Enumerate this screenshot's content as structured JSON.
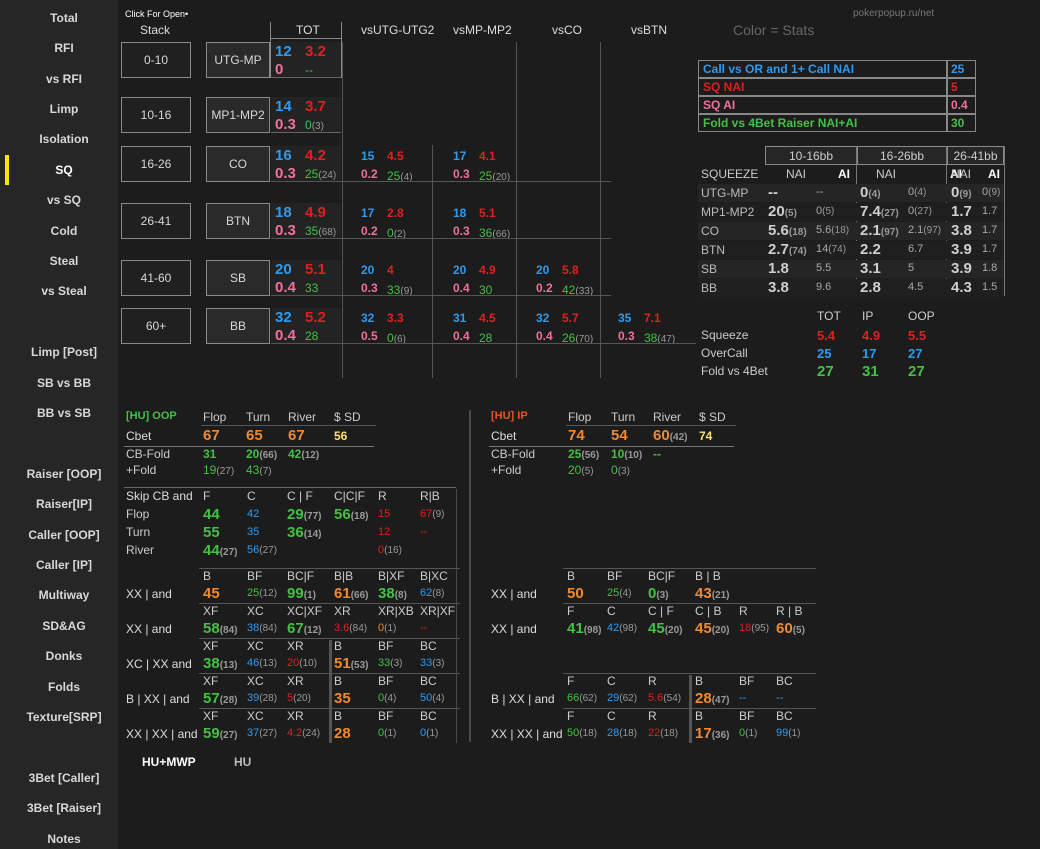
{
  "site": "pokerpopup.ru/net",
  "hint": "Click For Open•",
  "color_label": "Color = Stats",
  "nav": [
    "Total",
    "RFI",
    "vs RFI",
    "Limp",
    "Isolation",
    "SQ",
    "vs SQ",
    "Cold",
    "Steal",
    "vs Steal",
    "Limp [Post]",
    "SB vs BB",
    "BB vs SB",
    "Raiser [OOP]",
    "Raiser[IP]",
    "Caller [OOP]",
    "Caller [IP]",
    "Multiway",
    "SD&AG",
    "Donks",
    "Folds",
    "Texture[SRP]",
    "3Bet [Caller]",
    "3Bet [Raiser]",
    "Notes"
  ],
  "grid": {
    "stack_header": "Stack",
    "col_headers": [
      "TOT",
      "vsUTG-UTG2",
      "vsMP-MP2",
      "vsCO",
      "vsBTN"
    ],
    "stacks": [
      "0-10",
      "10-16",
      "16-26",
      "26-41",
      "41-60",
      "60+"
    ],
    "positions": [
      "UTG-MP",
      "MP1-MP2",
      "CO",
      "BTN",
      "SB",
      "BB"
    ],
    "tot": [
      {
        "a": "12",
        "b": "3.2",
        "c": "0",
        "d": "--",
        "e": ""
      },
      {
        "a": "14",
        "b": "3.7",
        "c": "0.3",
        "d": "0",
        "e": "(3)"
      },
      {
        "a": "16",
        "b": "4.2",
        "c": "0.3",
        "d": "25",
        "e": "(24)"
      },
      {
        "a": "18",
        "b": "4.9",
        "c": "0.3",
        "d": "35",
        "e": "(68)"
      },
      {
        "a": "20",
        "b": "5.1",
        "c": "0.4",
        "d": "33",
        "e": ""
      },
      {
        "a": "32",
        "b": "5.2",
        "c": "0.4",
        "d": "28",
        "e": ""
      }
    ],
    "vsutg": [
      null,
      null,
      {
        "a": "15",
        "b": "4.5",
        "c": "0.2",
        "d": "25",
        "e": "(4)"
      },
      {
        "a": "17",
        "b": "2.8",
        "c": "0.2",
        "d": "0",
        "e": "(2)"
      },
      {
        "a": "20",
        "b": "4",
        "c": "0.3",
        "d": "33",
        "e": "(9)"
      },
      {
        "a": "32",
        "b": "3.3",
        "c": "0.5",
        "d": "0",
        "e": "(6)"
      }
    ],
    "vsmp": [
      null,
      null,
      {
        "a": "17",
        "b": "4.1",
        "c": "0.3",
        "d": "25",
        "e": "(20)"
      },
      {
        "a": "18",
        "b": "5.1",
        "c": "0.3",
        "d": "36",
        "e": "(66)"
      },
      {
        "a": "20",
        "b": "4.9",
        "c": "0.4",
        "d": "30",
        "e": ""
      },
      {
        "a": "31",
        "b": "4.5",
        "c": "0.4",
        "d": "28",
        "e": ""
      }
    ],
    "vsco": [
      null,
      null,
      null,
      null,
      {
        "a": "20",
        "b": "5.8",
        "c": "0.2",
        "d": "42",
        "e": "(33)"
      },
      {
        "a": "32",
        "b": "5.7",
        "c": "0.4",
        "d": "26",
        "e": "(70)"
      }
    ],
    "vsbtn": [
      null,
      null,
      null,
      null,
      null,
      {
        "a": "35",
        "b": "7.1",
        "c": "0.3",
        "d": "38",
        "e": "(47)"
      }
    ]
  },
  "legend": [
    {
      "label": "Call vs OR and 1+ Call NAI",
      "value": "25",
      "color": "#2f9bf0"
    },
    {
      "label": "SQ NAI",
      "value": "5",
      "color": "#e02020"
    },
    {
      "label": "SQ AI",
      "value": "0.4",
      "color": "#f070a0"
    },
    {
      "label": "Fold vs 4Bet Raiser NAI+AI",
      "value": "30",
      "color": "#45c045"
    }
  ],
  "squeeze": {
    "groups": [
      "10-16bb",
      "16-26bb",
      "26-41bb"
    ],
    "title": "SQUEEZE",
    "nai": "NAI",
    "ai": "AI",
    "rows": [
      {
        "pos": "UTG-MP",
        "v": [
          [
            "--",
            ""
          ],
          [
            "--",
            ""
          ],
          [
            "0",
            "(4)"
          ],
          [
            "0",
            "(4)"
          ],
          [
            "0",
            "(9)"
          ],
          [
            "0",
            "(9)"
          ]
        ]
      },
      {
        "pos": "MP1-MP2",
        "v": [
          [
            "20",
            "(5)"
          ],
          [
            "0",
            "(5)"
          ],
          [
            "7.4",
            "(27)"
          ],
          [
            "0",
            "(27)"
          ],
          [
            "1.7",
            ""
          ],
          [
            "1.7",
            ""
          ]
        ]
      },
      {
        "pos": "CO",
        "v": [
          [
            "5.6",
            "(18)"
          ],
          [
            "5.6",
            "(18)"
          ],
          [
            "2.1",
            "(97)"
          ],
          [
            "2.1",
            "(97)"
          ],
          [
            "3.8",
            ""
          ],
          [
            "1.7",
            ""
          ]
        ]
      },
      {
        "pos": "BTN",
        "v": [
          [
            "2.7",
            "(74)"
          ],
          [
            "14",
            "(74)"
          ],
          [
            "2.2",
            ""
          ],
          [
            "6.7",
            ""
          ],
          [
            "3.9",
            ""
          ],
          [
            "1.7",
            ""
          ]
        ]
      },
      {
        "pos": "SB",
        "v": [
          [
            "1.8",
            ""
          ],
          [
            "5.5",
            ""
          ],
          [
            "3.1",
            ""
          ],
          [
            "5",
            ""
          ],
          [
            "3.9",
            ""
          ],
          [
            "1.8",
            ""
          ]
        ]
      },
      {
        "pos": "BB",
        "v": [
          [
            "3.8",
            ""
          ],
          [
            "9.6",
            ""
          ],
          [
            "2.8",
            ""
          ],
          [
            "4.5",
            ""
          ],
          [
            "4.3",
            ""
          ],
          [
            "1.5",
            ""
          ]
        ]
      }
    ],
    "summary_headers": [
      "TOT",
      "IP",
      "OOP"
    ],
    "summary": [
      {
        "label": "Squeeze",
        "v": [
          "5.4",
          "4.9",
          "5.5"
        ],
        "color": "#e02020"
      },
      {
        "label": "OverCall",
        "v": [
          "25",
          "17",
          "27"
        ],
        "color": "#2f9bf0"
      },
      {
        "label": "Fold vs 4Bet",
        "v": [
          "27",
          "31",
          "27"
        ],
        "color": "#45c045"
      }
    ]
  },
  "oop": {
    "title": "[HU] OOP",
    "headers": [
      "Flop",
      "Turn",
      "River",
      "$ SD"
    ],
    "cbet": {
      "label": "Cbet",
      "v": [
        "67",
        "65",
        "67",
        "56"
      ]
    },
    "cbfold": {
      "label": "CB-Fold",
      "v": [
        [
          "31",
          ""
        ],
        [
          "20",
          "(66)"
        ],
        [
          "42",
          "(12)"
        ]
      ]
    },
    "plusfold": {
      "label": "+Fold",
      "v": [
        [
          "19",
          "(27)"
        ],
        [
          "43",
          "(7)"
        ]
      ]
    },
    "skip": {
      "label": "Skip CB and",
      "headers": [
        "F",
        "C",
        "C | F",
        "C|C|F",
        "R",
        "R|B"
      ],
      "rows": [
        {
          "label": "Flop",
          "v": [
            [
              "44",
              ""
            ],
            [
              "42",
              ""
            ],
            [
              "29",
              "(77)"
            ],
            [
              "56",
              "(18)"
            ],
            [
              "15",
              ""
            ],
            [
              "67",
              "(9)"
            ]
          ]
        },
        {
          "label": "Turn",
          "v": [
            [
              "55",
              ""
            ],
            [
              "35",
              ""
            ],
            [
              "36",
              "(14)"
            ],
            [
              "",
              ""
            ],
            [
              "12",
              ""
            ],
            [
              "--",
              ""
            ]
          ]
        },
        {
          "label": "River",
          "v": [
            [
              "44",
              "(27)"
            ],
            [
              "56",
              "(27)"
            ],
            [
              "",
              ""
            ],
            [
              "",
              ""
            ],
            [
              "0",
              "(16)"
            ],
            [
              "",
              ""
            ]
          ]
        }
      ]
    },
    "lines": [
      {
        "label": "XX | and",
        "headers": [
          "B",
          "BF",
          "BC|F",
          "B|B",
          "B|XF",
          "B|XC"
        ],
        "v": [
          [
            "45",
            ""
          ],
          [
            "25",
            "(12)"
          ],
          [
            "99",
            "(1)"
          ],
          [
            "61",
            "(66)"
          ],
          [
            "38",
            "(8)"
          ],
          [
            "62",
            "(8)"
          ]
        ]
      },
      {
        "label": "XX | and",
        "headers": [
          "XF",
          "XC",
          "XC|XF",
          "XR",
          "XR|XB",
          "XR|XF"
        ],
        "v": [
          [
            "58",
            "(84)"
          ],
          [
            "38",
            "(84)"
          ],
          [
            "67",
            "(12)"
          ],
          [
            "3.6",
            "(84)"
          ],
          [
            "0",
            "(1)"
          ],
          [
            "--",
            ""
          ]
        ]
      },
      {
        "label": "XC | XX and",
        "headers": [
          "XF",
          "XC",
          "XR",
          "B",
          "BF",
          "BC"
        ],
        "v": [
          [
            "38",
            "(13)"
          ],
          [
            "46",
            "(13)"
          ],
          [
            "20",
            "(10)"
          ],
          [
            "51",
            "(53)"
          ],
          [
            "33",
            "(3)"
          ],
          [
            "33",
            "(3)"
          ]
        ]
      },
      {
        "label": "B | XX | and",
        "headers": [
          "XF",
          "XC",
          "XR",
          "B",
          "BF",
          "BC"
        ],
        "v": [
          [
            "57",
            "(28)"
          ],
          [
            "39",
            "(28)"
          ],
          [
            "5",
            "(20)"
          ],
          [
            "35",
            ""
          ],
          [
            "0",
            "(4)"
          ],
          [
            "50",
            "(4)"
          ]
        ]
      },
      {
        "label": "XX | XX | and",
        "headers": [
          "XF",
          "XC",
          "XR",
          "B",
          "BF",
          "BC"
        ],
        "v": [
          [
            "59",
            "(27)"
          ],
          [
            "37",
            "(27)"
          ],
          [
            "4.2",
            "(24)"
          ],
          [
            "28",
            ""
          ],
          [
            "0",
            "(1)"
          ],
          [
            "0",
            "(1)"
          ]
        ]
      }
    ]
  },
  "ip": {
    "title": "[HU] IP",
    "headers": [
      "Flop",
      "Turn",
      "River",
      "$ SD"
    ],
    "cbet": {
      "label": "Cbet",
      "v": [
        "74",
        "54",
        "60",
        "74"
      ],
      "river_sub": "(42)"
    },
    "cbfold": {
      "label": "CB-Fold",
      "v": [
        [
          "25",
          "(56)"
        ],
        [
          "10",
          "(10)"
        ],
        [
          "--",
          ""
        ]
      ]
    },
    "plusfold": {
      "label": "+Fold",
      "v": [
        [
          "20",
          "(5)"
        ],
        [
          "0",
          "(3)"
        ]
      ]
    },
    "lines": [
      {
        "label": "XX | and",
        "headers": [
          "B",
          "BF",
          "BC|F",
          "B | B"
        ],
        "v": [
          [
            "50",
            ""
          ],
          [
            "25",
            "(4)"
          ],
          [
            "0",
            "(3)"
          ],
          [
            "43",
            "(21)"
          ]
        ]
      },
      {
        "label": "XX | and",
        "headers": [
          "F",
          "C",
          "C | F",
          "C | B",
          "R",
          "R | B"
        ],
        "v": [
          [
            "41",
            "(98)"
          ],
          [
            "42",
            "(98)"
          ],
          [
            "45",
            "(20)"
          ],
          [
            "45",
            "(20)"
          ],
          [
            "18",
            "(95)"
          ],
          [
            "60",
            "(5)"
          ]
        ]
      },
      {
        "label": "B | XX | and",
        "headers": [
          "F",
          "C",
          "R",
          "B",
          "BF",
          "BC"
        ],
        "v": [
          [
            "66",
            "(62)"
          ],
          [
            "29",
            "(62)"
          ],
          [
            "5.6",
            "(54)"
          ],
          [
            "28",
            "(47)"
          ],
          [
            "--",
            ""
          ],
          [
            "--",
            ""
          ]
        ]
      },
      {
        "label": "XX | XX | and",
        "headers": [
          "F",
          "C",
          "R",
          "B",
          "BF",
          "BC"
        ],
        "v": [
          [
            "50",
            "(18)"
          ],
          [
            "28",
            "(18)"
          ],
          [
            "22",
            "(18)"
          ],
          [
            "17",
            "(36)"
          ],
          [
            "0",
            "(1)"
          ],
          [
            "99",
            "(1)"
          ]
        ]
      }
    ]
  },
  "tabs": [
    "HU+MWP",
    "HU"
  ],
  "colors": {
    "blue": "#2f9bf0",
    "red": "#e02020",
    "pink": "#f070a0",
    "green": "#45c045",
    "orange": "#f08a30",
    "yellow": "#ffe070",
    "accent": "#ffe600"
  }
}
